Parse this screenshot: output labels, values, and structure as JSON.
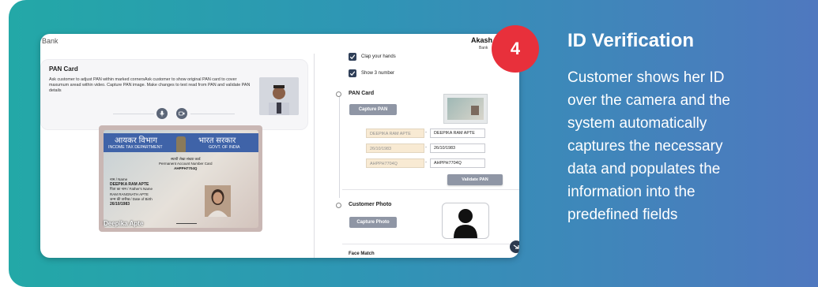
{
  "app": {
    "bank_name": "Bank",
    "user_name": "Akash",
    "user_sub": "Bank"
  },
  "pan_panel": {
    "title": "PAN Card",
    "instructions": "Ask customer to adjust PAN within marked cornersAsk customer to show original PAN card to cover maxumum aread within video. Capture PAN image. Make changes to text read from PAN and validate PAN details"
  },
  "id_card": {
    "hindi_left": "आयकर विभाग",
    "hindi_right": "भारत सरकार",
    "dept_en": "INCOME TAX DEPARTMENT",
    "govt_en": "GOVT. OF INDIA",
    "pan_label_hi": "स्थायी लेखा संख्या कार्ड",
    "pan_label_en": "Permanent Account Number Card",
    "pan_number": "AHPPH7704Q",
    "name_label": "नाम / Name",
    "name": "DEEPIKA RAM APTE",
    "father_label": "पिता का नाम / Father's Name",
    "father": "RAM RANGNATH APTE",
    "dob_label": "जन्म की तारीख / Date of Birth",
    "dob": "26/10/1983",
    "overlay_name": "Deepika Apte"
  },
  "checklist": [
    {
      "label": "Clap your hands",
      "checked": true
    },
    {
      "label": "Show 3 number",
      "checked": true
    }
  ],
  "pan_section": {
    "title": "PAN Card",
    "capture_label": "Capture PAN",
    "fields": [
      {
        "read": "DEEPIKA RAM APTE",
        "value": "DEEPIKA RAM APTE"
      },
      {
        "read": "26/10/1983",
        "value": "26/10/1983"
      },
      {
        "read": "AHPPH7704Q",
        "value": "AHPPH7704Q"
      }
    ],
    "separator": "-",
    "validate_label": "Validate PAN"
  },
  "photo_section": {
    "title": "Customer Photo",
    "capture_label": "Capture Photo"
  },
  "next_section": {
    "title": "Face Match"
  },
  "step": {
    "number": "4",
    "title": "ID Verification",
    "description_lines": [
      "Customer shows her ID",
      "over the camera and the",
      "system automatically",
      "captures the necessary",
      "data and populates the",
      "information into the",
      "predefined fields"
    ]
  },
  "colors": {
    "badge": "#e8303b",
    "gradient_start": "#23a8a7",
    "gradient_end": "#4f78bf",
    "button": "#8f96a5"
  },
  "icons": [
    "mic-icon",
    "video-icon",
    "check-icon",
    "person-icon",
    "scroll-down-icon"
  ]
}
